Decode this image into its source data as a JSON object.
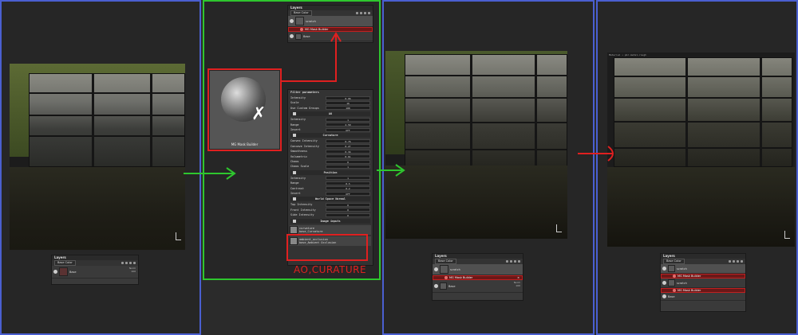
{
  "layers_panel": {
    "title": "Layers",
    "channel": "Base Color",
    "layers": [
      {
        "name": "scratch",
        "blend": "Norm",
        "opacity": "100"
      },
      {
        "name": "Base",
        "blend": "Norm",
        "opacity": "100"
      }
    ],
    "mask_generator": "MG Mask Builder",
    "mask_close": "×"
  },
  "icon_card": {
    "label": "MG Mask Builder"
  },
  "filter_params": {
    "title": "Filter parameters",
    "rows_top": [
      {
        "label": "Intensity",
        "value": "0.96"
      },
      {
        "label": "Scale",
        "value": "16"
      },
      {
        "label": "Use Custom Groups",
        "value": "100"
      }
    ],
    "sections": [
      {
        "name": "AO",
        "rows": [
          {
            "label": "Intensity",
            "value": "1"
          },
          {
            "label": "Range",
            "value": "2.50"
          },
          {
            "label": "Invert",
            "value": "OFF"
          }
        ]
      },
      {
        "name": "Curvature",
        "rows": [
          {
            "label": "Convex Intensity",
            "value": "0.76"
          },
          {
            "label": "Concave Intensity",
            "value": "0.27"
          },
          {
            "label": "Smoothness",
            "value": "0.34"
          },
          {
            "label": "Volumetric",
            "value": "0.61"
          },
          {
            "label": "Chaos",
            "value": "0"
          },
          {
            "label": "Chaos Scale",
            "value": "1"
          }
        ]
      },
      {
        "name": "Position",
        "rows": [
          {
            "label": "Intensity",
            "value": "1"
          },
          {
            "label": "Range",
            "value": "0.5"
          },
          {
            "label": "Contrast",
            "value": "0.2"
          },
          {
            "label": "Invert",
            "value": "OFF"
          }
        ]
      },
      {
        "name": "World Space Normal",
        "rows": [
          {
            "label": "Top Intensity",
            "value": "0"
          },
          {
            "label": "Front Intensity",
            "value": "0"
          },
          {
            "label": "Side Intensity",
            "value": "0"
          }
        ]
      },
      {
        "name": "Image inputs",
        "rows": []
      }
    ],
    "image_inputs": [
      {
        "name": "curvature",
        "source": "base_Curvature"
      },
      {
        "name": "ambient_occlusion",
        "source": "base_Ambient Occlusion"
      }
    ]
  },
  "caption": "AO,CURATURE",
  "viewport_tags": [
    "Mat • pbr-metal-rough",
    "Material • pbr-metal-rough",
    "Material • pbr-metal-rough"
  ],
  "colors": {
    "blue_frame": "#4a5fd0",
    "green_frame": "#2ec62e",
    "red_highlight": "#e02020"
  }
}
